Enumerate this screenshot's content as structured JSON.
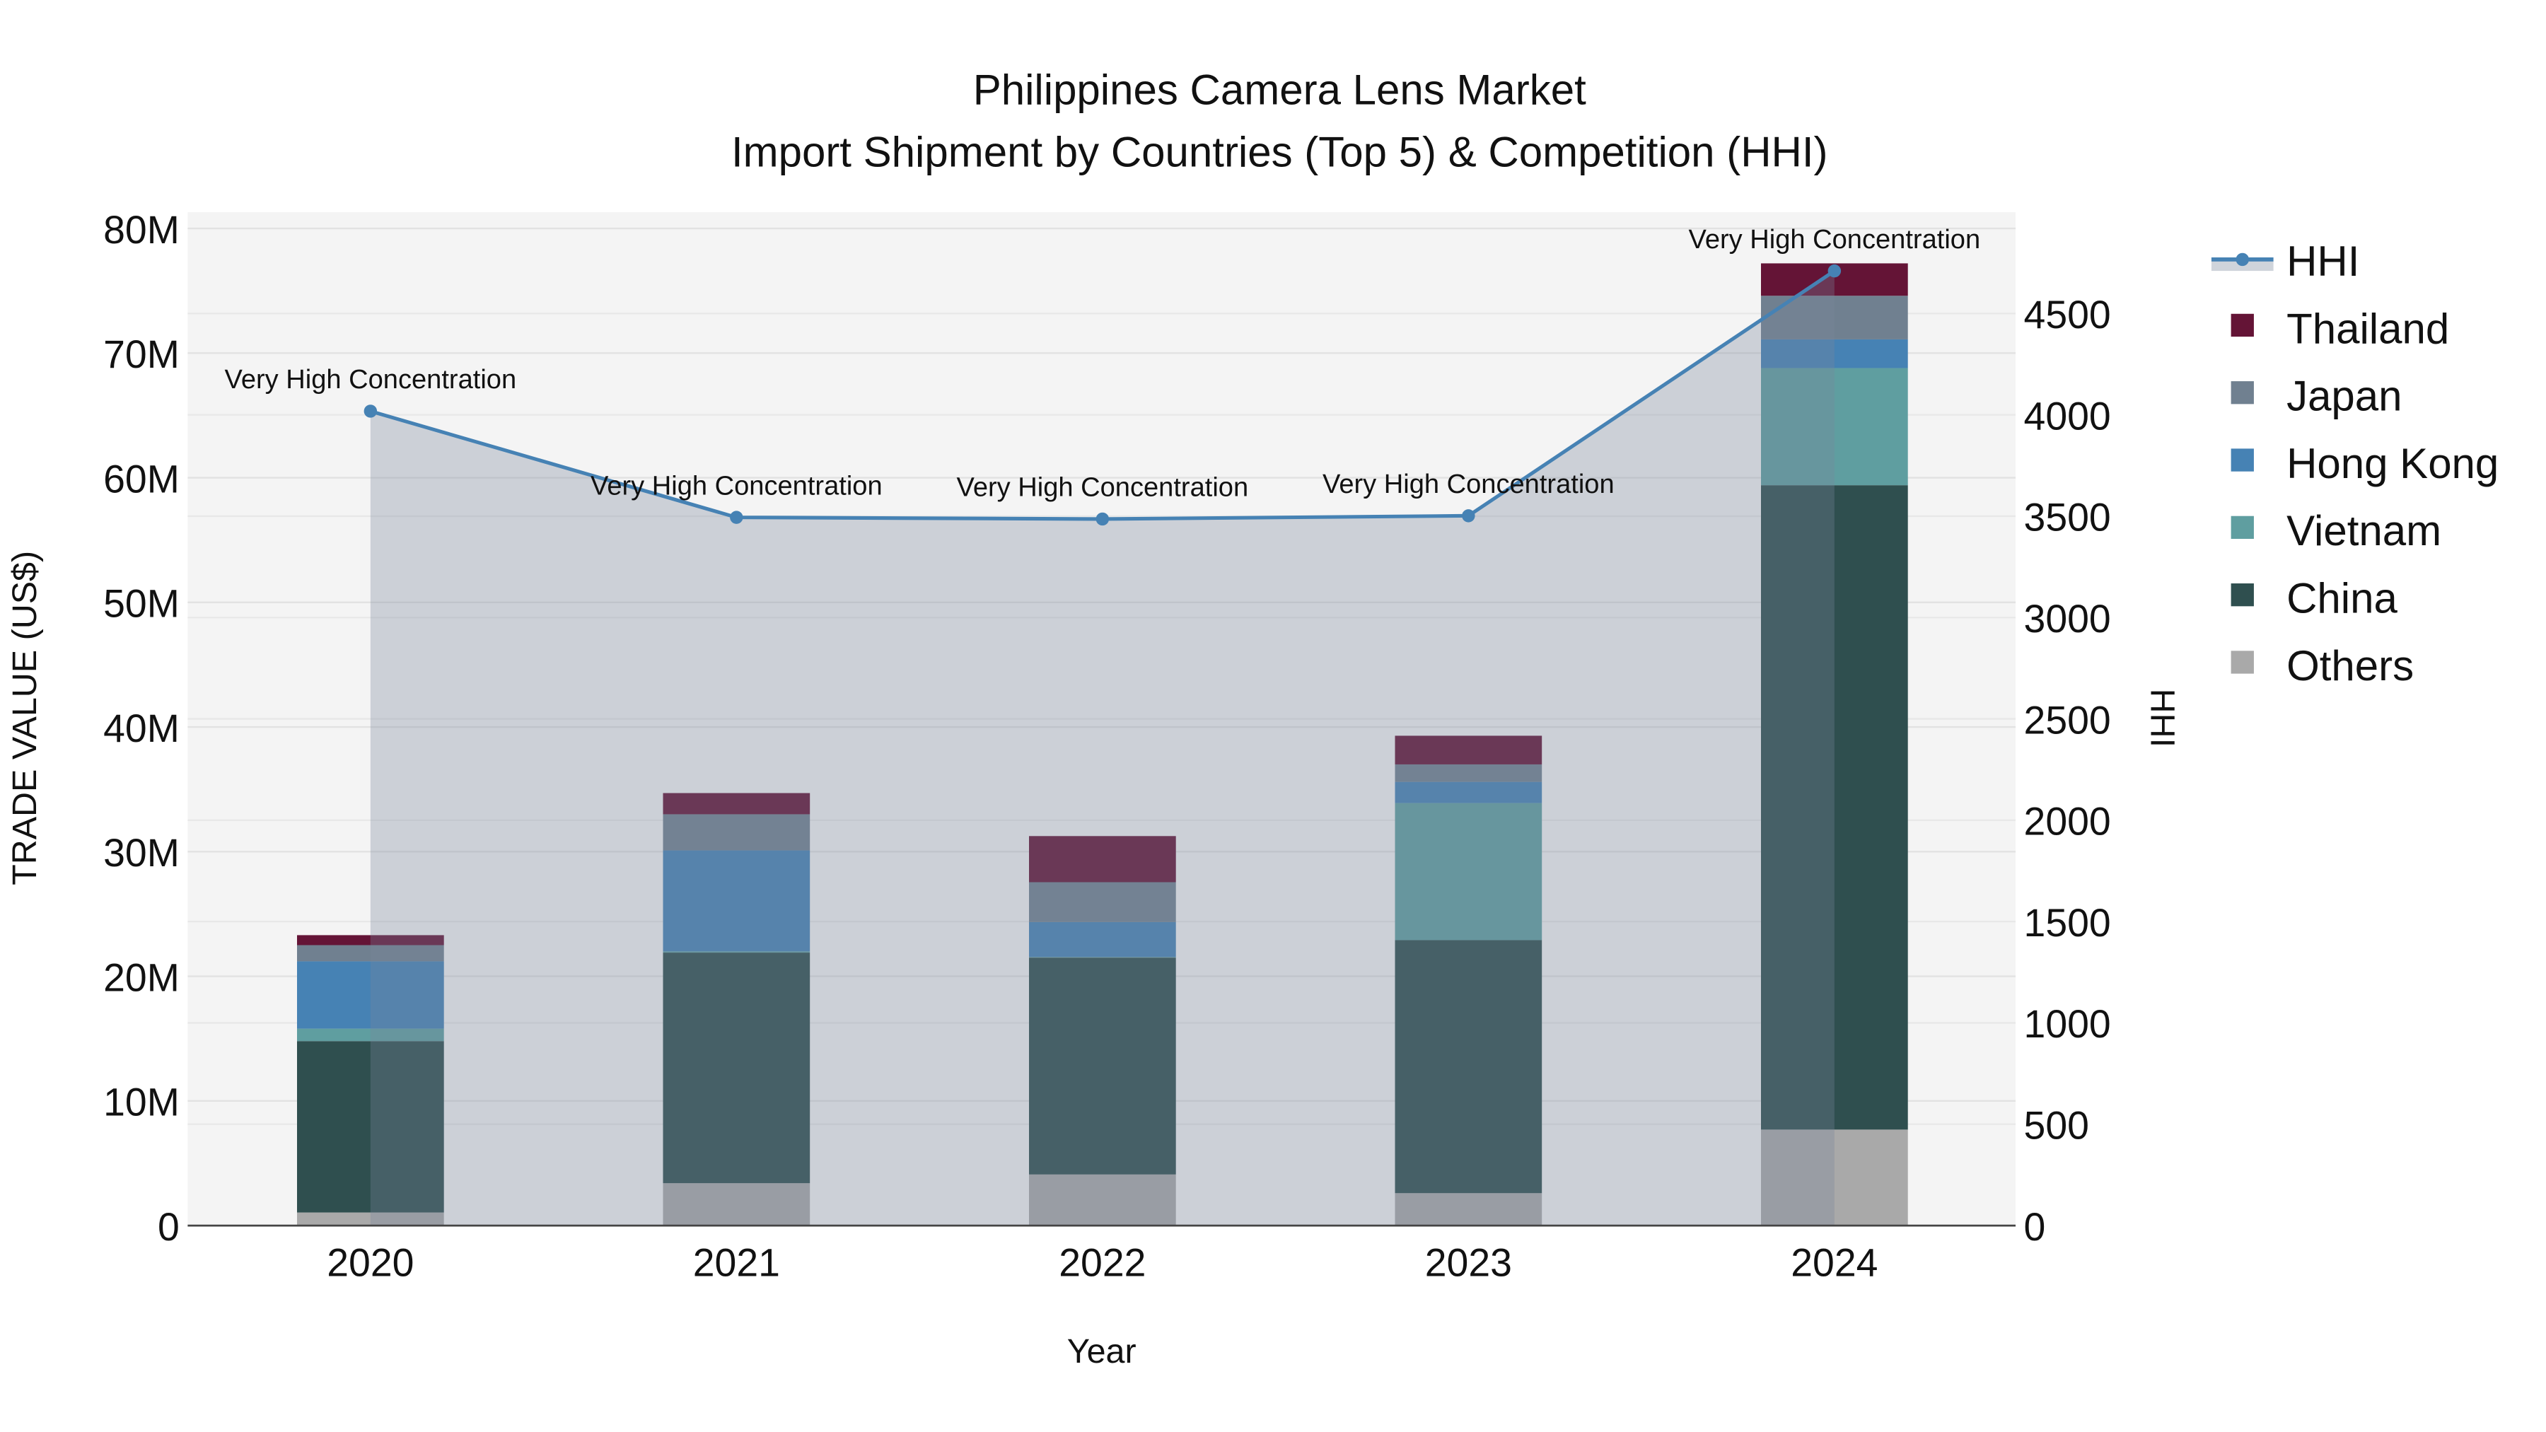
{
  "chart_data": {
    "type": "bar",
    "title": "Philippines Camera Lens Market",
    "subtitle": "Import Shipment by Countries (Top 5) & Competition (HHI)",
    "xlabel": "Year",
    "ylabel": "TRADE VALUE (US$)",
    "y2label": "HHI",
    "categories": [
      "2020",
      "2021",
      "2022",
      "2023",
      "2024"
    ],
    "ylim": [
      0,
      80000000
    ],
    "y2lim": [
      0,
      4900
    ],
    "yticks": [
      "0",
      "10M",
      "20M",
      "30M",
      "40M",
      "50M",
      "60M",
      "70M",
      "80M"
    ],
    "y2ticks": [
      "0",
      "500",
      "1000",
      "1500",
      "2000",
      "2500",
      "3000",
      "3500",
      "4000",
      "4500"
    ],
    "stacked": true,
    "series": [
      {
        "name": "Others",
        "color": "#a9a9a9",
        "values": [
          1050000,
          3400000,
          4100000,
          2600000,
          7700000
        ]
      },
      {
        "name": "China",
        "color": "#2f4f4f",
        "values": [
          13750000,
          18500000,
          17400000,
          20300000,
          51700000
        ]
      },
      {
        "name": "Vietnam",
        "color": "#5f9ea0",
        "values": [
          1000000,
          100000,
          50000,
          11000000,
          9400000
        ]
      },
      {
        "name": "Hong Kong",
        "color": "#4682b4",
        "values": [
          5400000,
          8100000,
          2800000,
          1700000,
          2300000
        ]
      },
      {
        "name": "Japan",
        "color": "#708090",
        "values": [
          1300000,
          2900000,
          3200000,
          1400000,
          3500000
        ]
      },
      {
        "name": "Thailand",
        "color": "#641436",
        "values": [
          800000,
          1700000,
          3700000,
          2300000,
          2600000
        ]
      }
    ],
    "line": {
      "name": "HHI",
      "color": "#4682b4",
      "values": [
        4018,
        3494,
        3486,
        3502,
        4710
      ]
    },
    "annotations": [
      "Very High Concentration",
      "Very High Concentration",
      "Very High Concentration",
      "Very High Concentration",
      "Very High Concentration"
    ],
    "legend_order": [
      "HHI",
      "Thailand",
      "Japan",
      "Hong Kong",
      "Vietnam",
      "China",
      "Others"
    ],
    "legend_placement": "right",
    "grid": true
  }
}
